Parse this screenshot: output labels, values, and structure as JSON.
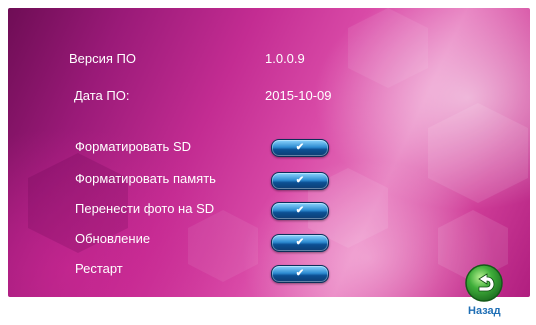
{
  "info": {
    "version_label": "Версия ПО",
    "version_value": "1.0.0.9",
    "date_label": "Дата ПО:",
    "date_value": "2015-10-09"
  },
  "actions": [
    {
      "label": "Форматировать  SD",
      "button_glyph": "✔"
    },
    {
      "label": "Форматировать память",
      "button_glyph": "✔"
    },
    {
      "label": "Перенести фото на SD",
      "button_glyph": "✔"
    },
    {
      "label": "Обновление",
      "button_glyph": "✔"
    },
    {
      "label": "Рестарт",
      "button_glyph": "✔"
    }
  ],
  "back": {
    "label": "Назад",
    "icon": "back-arrow-icon"
  },
  "colors": {
    "background_accent": "#c32c92",
    "button_blue": "#2d8bd1",
    "back_green": "#3fae3a",
    "back_label": "#1f6fb5"
  }
}
